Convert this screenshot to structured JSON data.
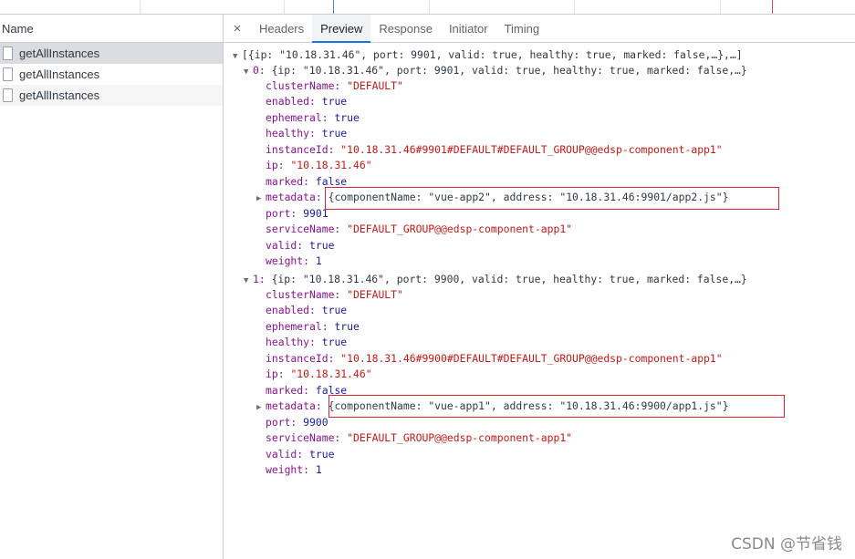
{
  "left_panel": {
    "header": "Name",
    "requests": [
      {
        "name": "getAllInstances"
      },
      {
        "name": "getAllInstances"
      },
      {
        "name": "getAllInstances"
      }
    ]
  },
  "tabs": {
    "close": "×",
    "items": [
      "Headers",
      "Preview",
      "Response",
      "Initiator",
      "Timing"
    ],
    "active": "Preview"
  },
  "preview": {
    "root_summary": "[{ip: \"10.18.31.46\", port: 9901, valid: true, healthy: true, marked: false,…},…]",
    "instances": [
      {
        "index_label": "0:",
        "summary": "{ip: \"10.18.31.46\", port: 9901, valid: true, healthy: true, marked: false,…}",
        "clusterName": "\"DEFAULT\"",
        "enabled": "true",
        "ephemeral": "true",
        "healthy": "true",
        "instanceId": "\"10.18.31.46#9901#DEFAULT#DEFAULT_GROUP@@edsp-component-app1\"",
        "ip": "\"10.18.31.46\"",
        "marked": "false",
        "metadata": "{componentName: \"vue-app2\", address: \"10.18.31.46:9901/app2.js\"}",
        "port": "9901",
        "serviceName": "\"DEFAULT_GROUP@@edsp-component-app1\"",
        "valid": "true",
        "weight": "1"
      },
      {
        "index_label": "1:",
        "summary": "{ip: \"10.18.31.46\", port: 9900, valid: true, healthy: true, marked: false,…}",
        "clusterName": "\"DEFAULT\"",
        "enabled": "true",
        "ephemeral": "true",
        "healthy": "true",
        "instanceId": "\"10.18.31.46#9900#DEFAULT#DEFAULT_GROUP@@edsp-component-app1\"",
        "ip": "\"10.18.31.46\"",
        "marked": "false",
        "metadata": "{componentName: \"vue-app1\", address: \"10.18.31.46:9900/app1.js\"}",
        "port": "9900",
        "serviceName": "\"DEFAULT_GROUP@@edsp-component-app1\"",
        "valid": "true",
        "weight": "1"
      }
    ],
    "keys": {
      "clusterName": "clusterName:",
      "enabled": "enabled:",
      "ephemeral": "ephemeral:",
      "healthy": "healthy:",
      "instanceId": "instanceId:",
      "ip": "ip:",
      "marked": "marked:",
      "metadata": "metadata:",
      "port": "port:",
      "serviceName": "serviceName:",
      "valid": "valid:",
      "weight": "weight:"
    },
    "expand_icon": "▼",
    "collapse_icon": "▶"
  },
  "watermark": "CSDN @节省钱",
  "colors": {
    "key": "#881391",
    "string": "#c41a16",
    "number": "#1a1aa6",
    "highlight": "#d9232e",
    "tab_underline": "#1a73e8"
  }
}
